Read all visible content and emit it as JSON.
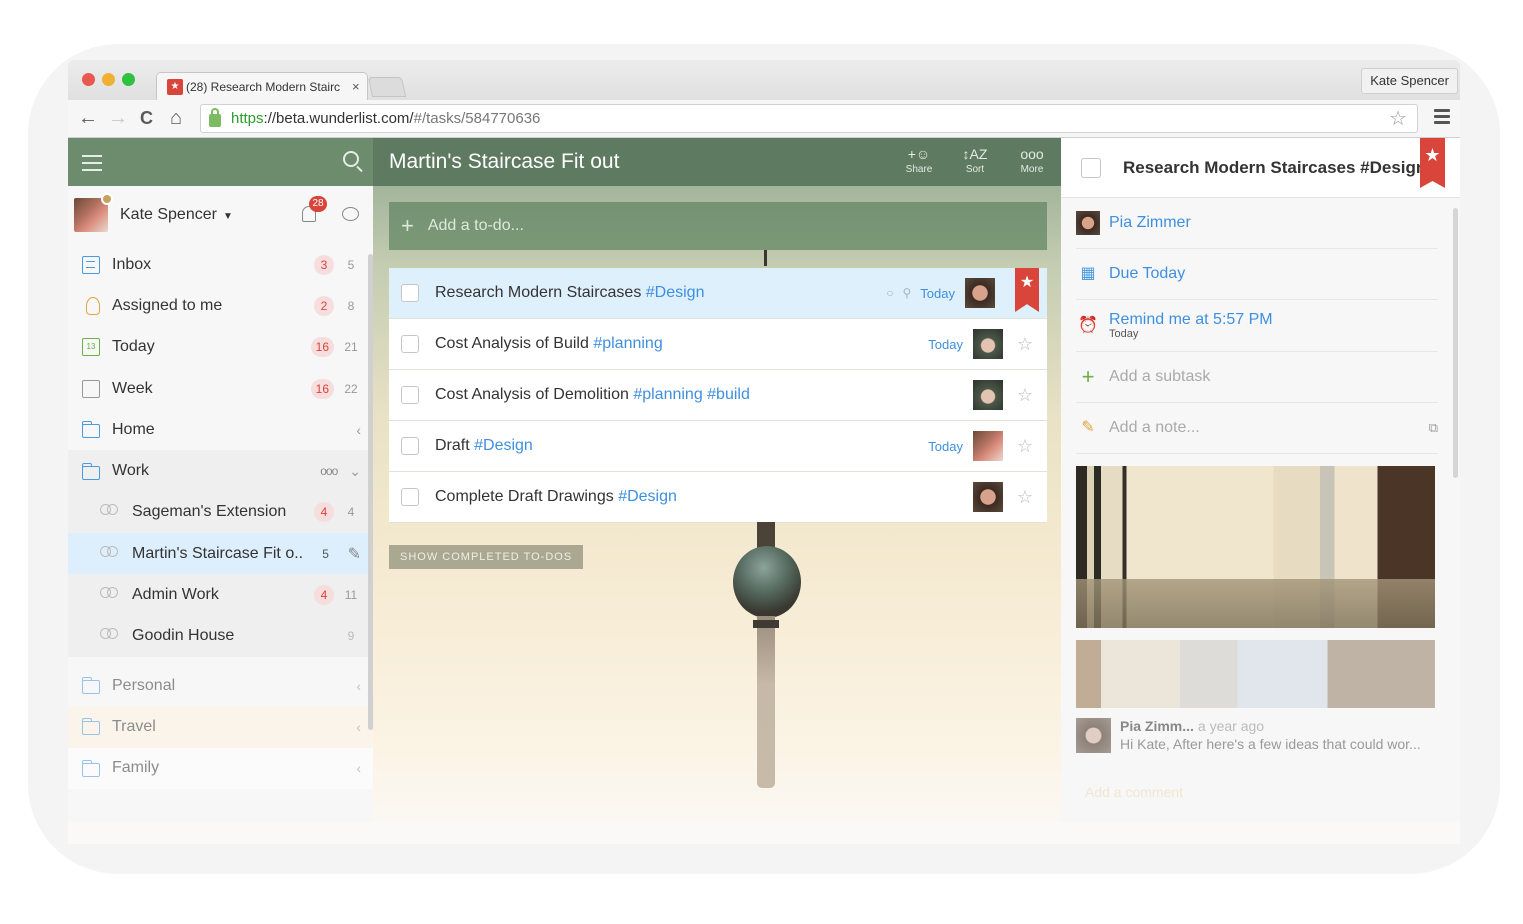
{
  "browser": {
    "tab_title": "(28) Research Modern Stairc",
    "tab_close": "×",
    "profile_name": "Kate Spencer",
    "url_https": "https",
    "url_host": "://beta.wunderlist.com/",
    "url_path": "#/tasks/584770636",
    "icons": {
      "back": "←",
      "forward": "→",
      "reload": "C",
      "home": "⌂",
      "bookmark": "☆"
    }
  },
  "sidebar": {
    "user": {
      "name": "Kate Spencer",
      "caret": "▼",
      "notifications": "28"
    },
    "items": [
      {
        "label": "Inbox",
        "overdue": "3",
        "count": "5",
        "icon": "inbox-icon"
      },
      {
        "label": "Assigned to me",
        "overdue": "2",
        "count": "8",
        "icon": "assigned-icon"
      },
      {
        "label": "Today",
        "overdue": "16",
        "count": "21",
        "icon": "calendar-today-icon",
        "icon_text": "13"
      },
      {
        "label": "Week",
        "overdue": "16",
        "count": "22",
        "icon": "calendar-week-icon"
      },
      {
        "label": "Home",
        "chevron": "‹",
        "icon": "folder-icon"
      },
      {
        "label": "Work",
        "more": "ooo",
        "chevron": "⌄",
        "icon": "folder-icon"
      },
      {
        "label": "Sageman's Extension",
        "overdue": "4",
        "count": "4",
        "icon": "shared-list-icon"
      },
      {
        "label": "Martin's Staircase Fit o..",
        "count": "5",
        "icon": "shared-list-icon",
        "edit": "✎"
      },
      {
        "label": "Admin Work",
        "overdue": "4",
        "count": "11",
        "icon": "shared-list-icon"
      },
      {
        "label": "Goodin House",
        "count": "9",
        "icon": "shared-list-icon"
      },
      {
        "label": "Personal",
        "chevron": "‹",
        "icon": "folder-icon"
      },
      {
        "label": "Travel",
        "chevron": "‹",
        "icon": "folder-icon"
      },
      {
        "label": "Family",
        "chevron": "‹",
        "icon": "folder-icon"
      }
    ]
  },
  "main": {
    "list_title": "Martin's Staircase Fit out",
    "toolbar": [
      {
        "label": "Share",
        "icon": "+☺"
      },
      {
        "label": "Sort",
        "icon": "↕AZ"
      },
      {
        "label": "More",
        "icon": "ooo"
      }
    ],
    "add_placeholder": "Add a to-do...",
    "add_plus": "+",
    "tasks": [
      {
        "title": "Research Modern Staircases",
        "tags": "#Design",
        "due": "Today",
        "starred": true,
        "selected": true,
        "has_comment": true,
        "has_attachment": true,
        "assignee": "Pia Zimmer"
      },
      {
        "title": "Cost Analysis of Build",
        "tags": "#planning",
        "due": "Today",
        "starred": false,
        "assignee": "man"
      },
      {
        "title": "Cost Analysis of Demolition",
        "tags": "#planning #build",
        "due": "",
        "starred": false,
        "assignee": "man"
      },
      {
        "title": "Draft",
        "tags": "#Design",
        "due": "Today",
        "starred": false,
        "assignee": "Kate Spencer"
      },
      {
        "title": "Complete Draft Drawings",
        "tags": "#Design",
        "due": "",
        "starred": false,
        "assignee": "Pia Zimmer"
      }
    ],
    "show_completed": "SHOW COMPLETED TO-DOS",
    "star_empty": "☆",
    "star_filled": "★",
    "comment_icon": "○",
    "pin_icon": "⚲"
  },
  "detail": {
    "title": "Research Modern Staircases #Design",
    "assignee": "Pia Zimmer",
    "due": "Due Today",
    "reminder": "Remind me at 5:57 PM",
    "reminder_sub": "Today",
    "add_subtask": "Add a subtask",
    "add_note": "Add a note...",
    "comment": {
      "author": "Pia Zimm...",
      "when": "a year ago",
      "text": "Hi Kate, After here's a few ideas that could wor..."
    },
    "add_comment": "Add a comment",
    "icons": {
      "plus": "+",
      "pencil": "✎",
      "alarm": "⏰",
      "calendar": "▦",
      "external": "⧉",
      "star": "★"
    }
  }
}
